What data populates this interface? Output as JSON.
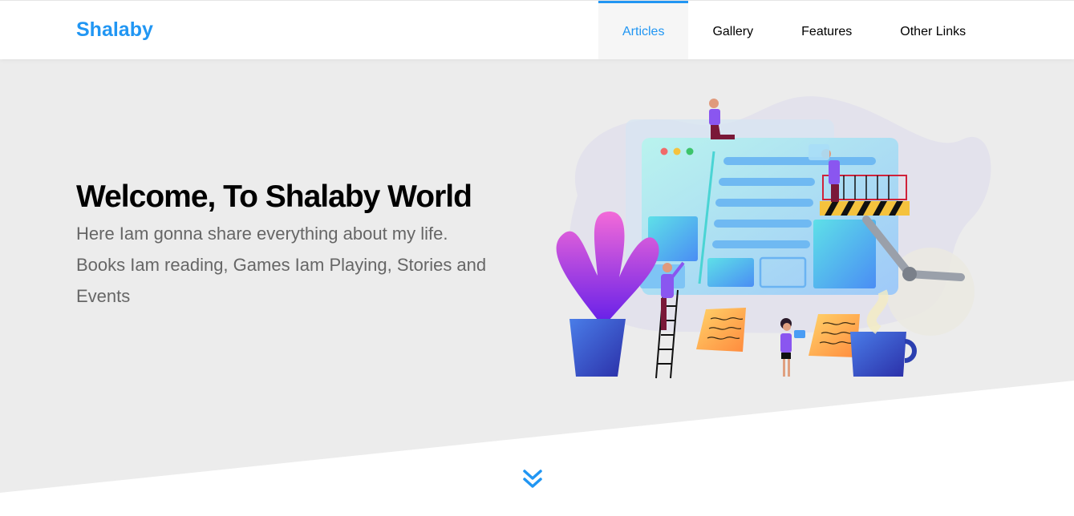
{
  "header": {
    "logo": "Shalaby",
    "nav": [
      {
        "label": "Articles",
        "active": true
      },
      {
        "label": "Gallery",
        "active": false
      },
      {
        "label": "Features",
        "active": false
      },
      {
        "label": "Other Links",
        "active": false
      }
    ]
  },
  "hero": {
    "title": "Welcome, To Shalaby World",
    "text": "Here Iam gonna share everything about my life. Books Iam reading, Games Iam Playing, Stories and Events",
    "scroll_icon": "double-chevron-down-icon"
  },
  "colors": {
    "accent": "#2196f3",
    "hero_background": "#ececec",
    "text_muted": "#666666"
  }
}
